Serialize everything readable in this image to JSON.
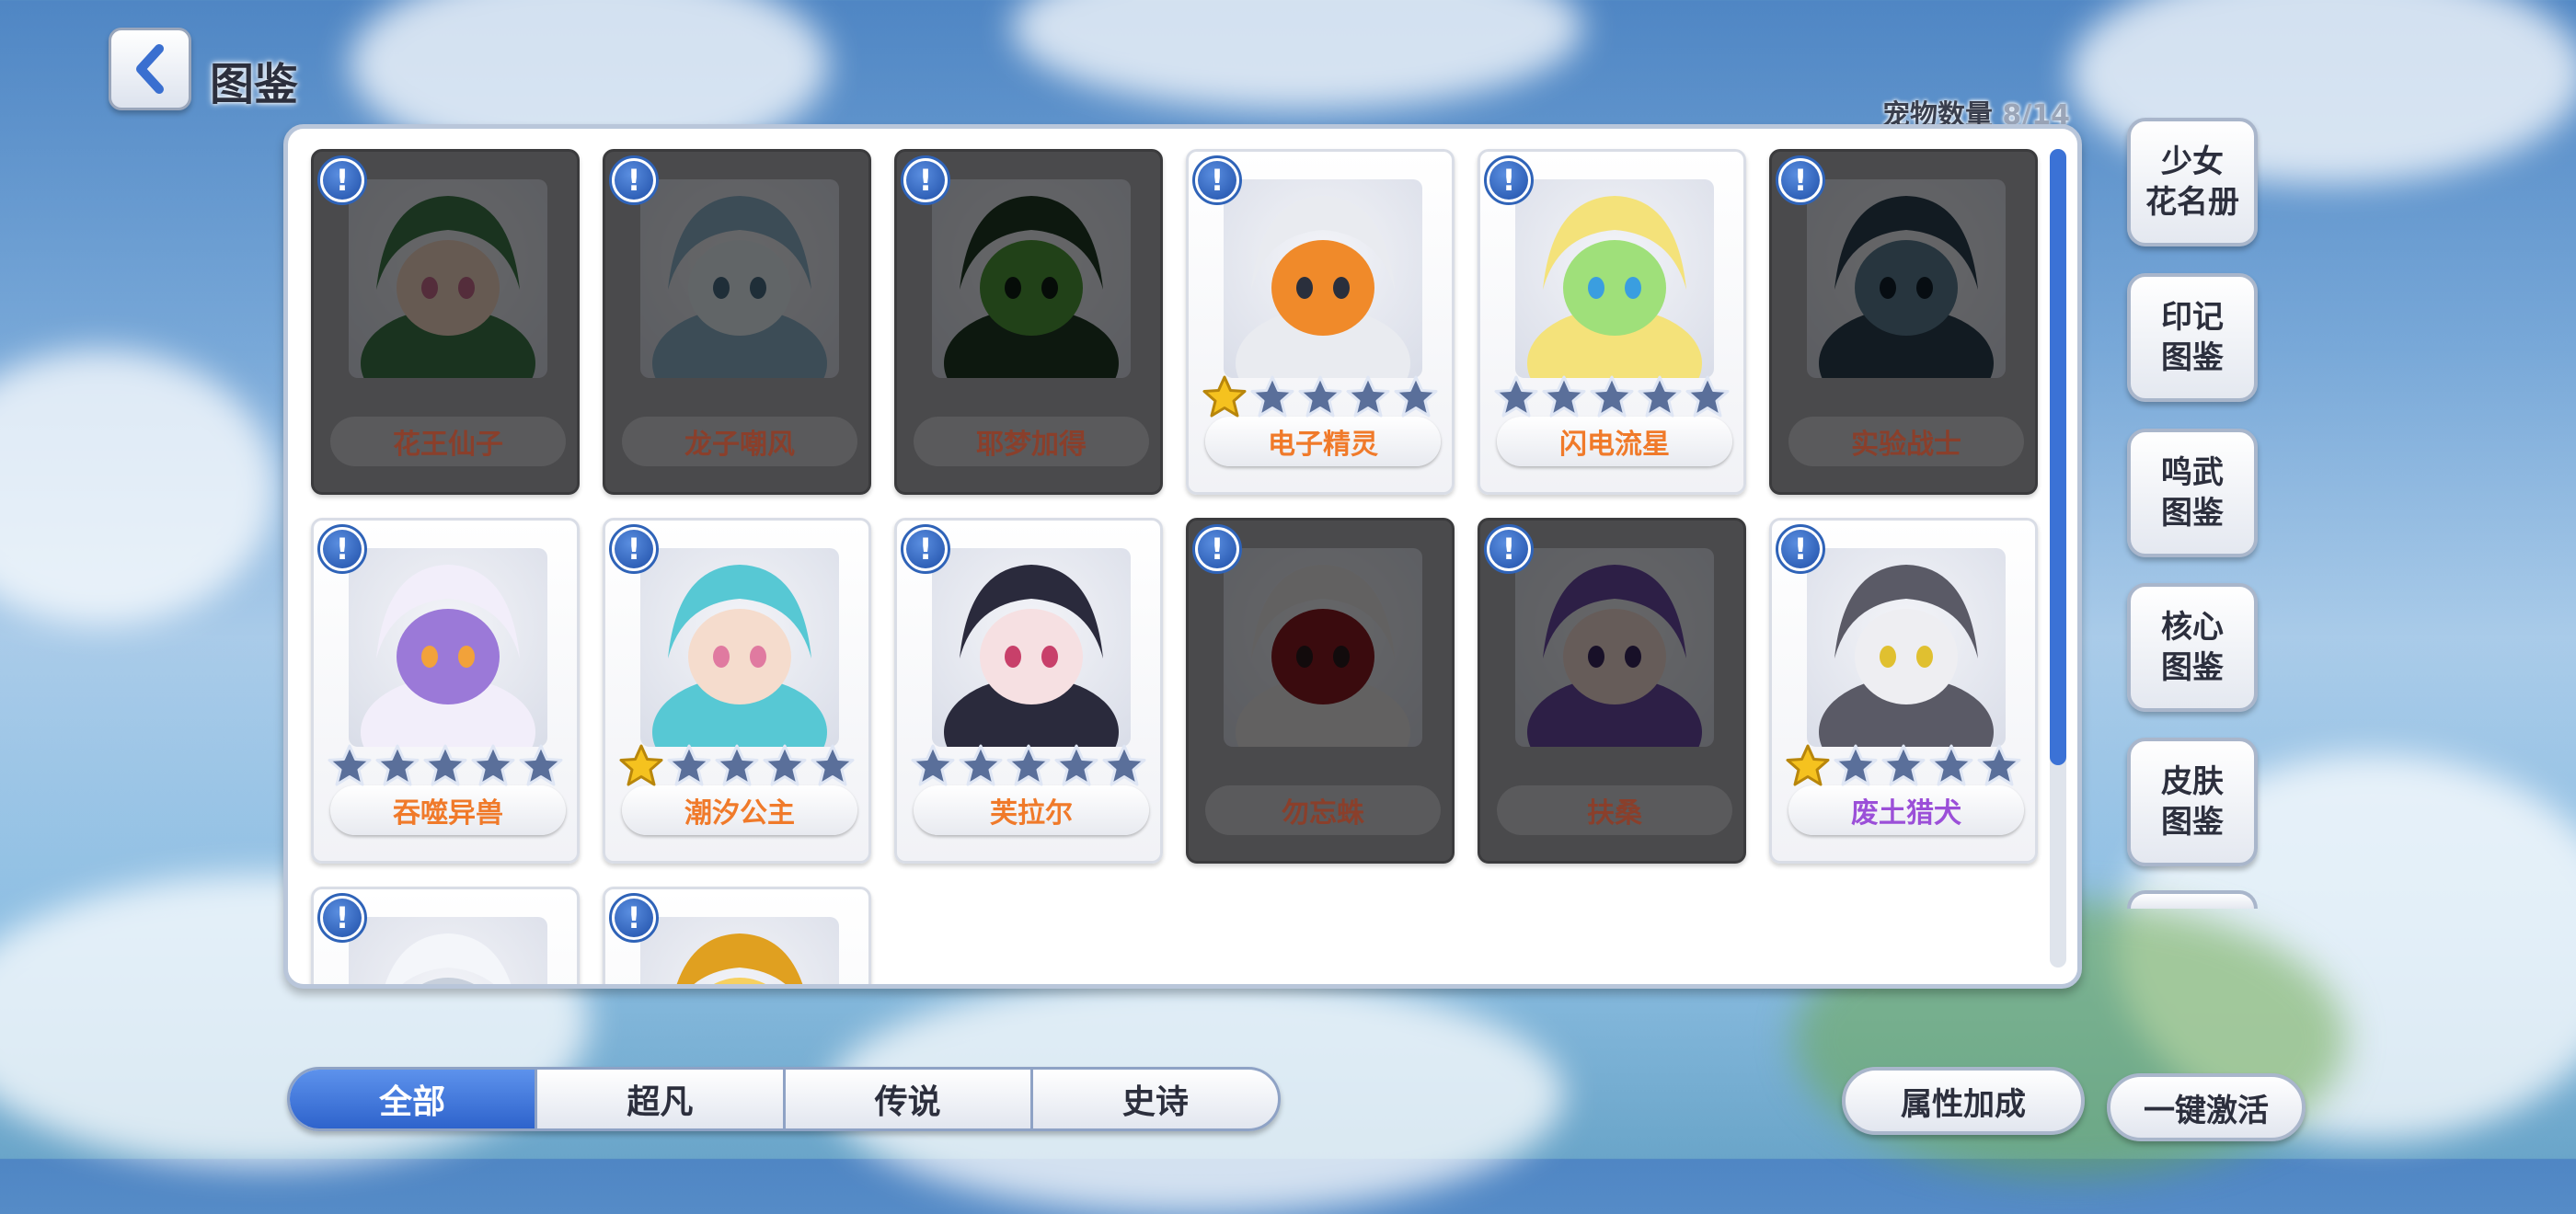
{
  "header": {
    "title": "图鉴",
    "back_icon": "chevron-left-icon"
  },
  "pet_count": {
    "label": "宠物数量",
    "value": "8/14"
  },
  "pets": [
    {
      "name": "花王仙子",
      "locked": true,
      "stars": 0,
      "art": "green-haired-fairy"
    },
    {
      "name": "龙子嘲风",
      "locked": true,
      "stars": 0,
      "art": "ice-dragon"
    },
    {
      "name": "耶梦加得",
      "locked": true,
      "stars": 0,
      "art": "green-serpent"
    },
    {
      "name": "电子精灵",
      "locked": false,
      "stars": 1,
      "art": "headphone-robot"
    },
    {
      "name": "闪电流星",
      "locked": false,
      "stars": 0,
      "art": "crystal-cat"
    },
    {
      "name": "实验战士",
      "locked": true,
      "stars": 0,
      "art": "dark-warrior"
    },
    {
      "name": "吞噬异兽",
      "locked": false,
      "stars": 0,
      "art": "white-beast"
    },
    {
      "name": "潮汐公主",
      "locked": false,
      "stars": 1,
      "art": "teal-mermaid"
    },
    {
      "name": "芙拉尔",
      "locked": false,
      "stars": 0,
      "art": "dark-haired-girl"
    },
    {
      "name": "勿忘蛛",
      "locked": true,
      "stars": 0,
      "art": "spider-girl"
    },
    {
      "name": "扶桑",
      "locked": true,
      "stars": 0,
      "art": "horned-girl"
    },
    {
      "name": "废土猎犬",
      "locked": false,
      "stars": 1,
      "art": "armored-wolf",
      "name_color": "purple"
    },
    {
      "name": "",
      "locked": false,
      "stars": 0,
      "art": "white-creature"
    },
    {
      "name": "",
      "locked": false,
      "stars": 0,
      "art": "golden-armor"
    }
  ],
  "side_buttons": [
    {
      "line1": "少女",
      "line2": "花名册"
    },
    {
      "line1": "印记",
      "line2": "图鉴"
    },
    {
      "line1": "鸣武",
      "line2": "图鉴"
    },
    {
      "line1": "核心",
      "line2": "图鉴"
    },
    {
      "line1": "皮肤",
      "line2": "图鉴"
    }
  ],
  "tabs": [
    {
      "label": "全部",
      "active": true
    },
    {
      "label": "超凡",
      "active": false
    },
    {
      "label": "传说",
      "active": false
    },
    {
      "label": "史诗",
      "active": false
    }
  ],
  "actions": {
    "attribute_bonus": "属性加成",
    "activate_all": "一键激活"
  },
  "colors": {
    "accent": "#3b72d6",
    "name_orange": "#f07a2a",
    "name_purple": "#9b4fd8",
    "locked_bg": "#4a4a4c"
  }
}
